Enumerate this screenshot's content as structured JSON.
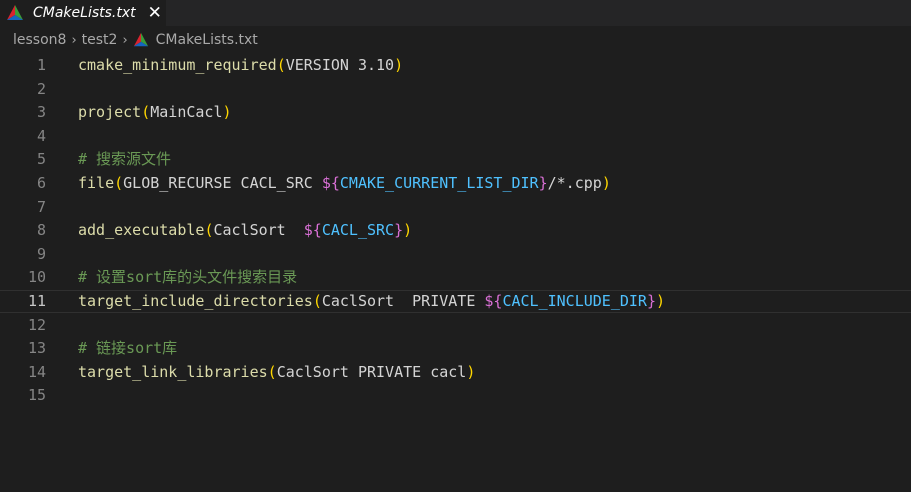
{
  "tab": {
    "title": "CMakeLists.txt",
    "close": "✕",
    "icon": "cmake-icon"
  },
  "breadcrumb": {
    "items": [
      "lesson8",
      "test2",
      "CMakeLists.txt"
    ],
    "separator": "›"
  },
  "editor": {
    "active_line": 11,
    "lines": [
      {
        "num": "1",
        "tokens": [
          {
            "t": "cmake_minimum_required",
            "c": "func"
          },
          {
            "t": "(",
            "c": "paren"
          },
          {
            "t": "VERSION 3.10",
            "c": "text"
          },
          {
            "t": ")",
            "c": "paren"
          }
        ]
      },
      {
        "num": "2",
        "tokens": []
      },
      {
        "num": "3",
        "tokens": [
          {
            "t": "project",
            "c": "func"
          },
          {
            "t": "(",
            "c": "paren"
          },
          {
            "t": "MainCacl",
            "c": "text"
          },
          {
            "t": ")",
            "c": "paren"
          }
        ]
      },
      {
        "num": "4",
        "tokens": []
      },
      {
        "num": "5",
        "tokens": [
          {
            "t": "# 搜索源文件",
            "c": "comment"
          }
        ]
      },
      {
        "num": "6",
        "tokens": [
          {
            "t": "file",
            "c": "func"
          },
          {
            "t": "(",
            "c": "paren"
          },
          {
            "t": "GLOB_RECURSE CACL_SRC ",
            "c": "text"
          },
          {
            "t": "${",
            "c": "brace"
          },
          {
            "t": "CMAKE_CURRENT_LIST_DIR",
            "c": "var"
          },
          {
            "t": "}",
            "c": "brace"
          },
          {
            "t": "/*.cpp",
            "c": "text"
          },
          {
            "t": ")",
            "c": "paren"
          }
        ]
      },
      {
        "num": "7",
        "tokens": []
      },
      {
        "num": "8",
        "tokens": [
          {
            "t": "add_executable",
            "c": "func"
          },
          {
            "t": "(",
            "c": "paren"
          },
          {
            "t": "CaclSort  ",
            "c": "text"
          },
          {
            "t": "${",
            "c": "brace"
          },
          {
            "t": "CACL_SRC",
            "c": "var"
          },
          {
            "t": "}",
            "c": "brace"
          },
          {
            "t": ")",
            "c": "paren"
          }
        ]
      },
      {
        "num": "9",
        "tokens": []
      },
      {
        "num": "10",
        "tokens": [
          {
            "t": "# 设置sort库的头文件搜索目录",
            "c": "comment"
          }
        ]
      },
      {
        "num": "11",
        "tokens": [
          {
            "t": "target_include_directories",
            "c": "func"
          },
          {
            "t": "(",
            "c": "paren"
          },
          {
            "t": "CaclSort  PRIVATE ",
            "c": "text"
          },
          {
            "t": "${",
            "c": "brace"
          },
          {
            "t": "CACL_INCLUDE_DIR",
            "c": "var"
          },
          {
            "t": "}",
            "c": "brace"
          },
          {
            "t": ")",
            "c": "paren"
          }
        ]
      },
      {
        "num": "12",
        "tokens": []
      },
      {
        "num": "13",
        "tokens": [
          {
            "t": "# 链接sort库",
            "c": "comment"
          }
        ]
      },
      {
        "num": "14",
        "tokens": [
          {
            "t": "target_link_libraries",
            "c": "func"
          },
          {
            "t": "(",
            "c": "paren"
          },
          {
            "t": "CaclSort PRIVATE cacl",
            "c": "text"
          },
          {
            "t": ")",
            "c": "paren"
          }
        ]
      },
      {
        "num": "15",
        "tokens": []
      }
    ]
  },
  "colors": {
    "background": "#1e1e1e",
    "function": "#dcdcaa",
    "paren": "#ffd700",
    "brace": "#da70d6",
    "variable": "#4fc1ff",
    "comment": "#6a9955",
    "text": "#d4d4d4"
  }
}
